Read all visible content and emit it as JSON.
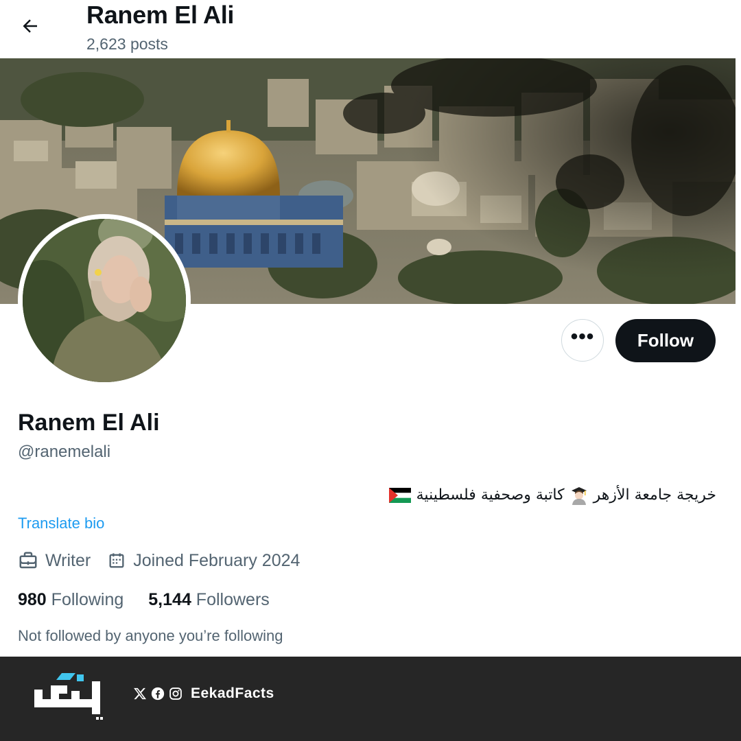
{
  "header": {
    "name": "Ranem El Ali",
    "posts": "2,623 posts"
  },
  "profile": {
    "display_name": "Ranem El Ali",
    "handle": "@ranemelali",
    "bio_text": "خريجة جامعة الأزهر 👩🏻‍🎓 كاتبة وصحفية فلسطينية 🇵🇸",
    "bio_part1": "خريجة جامعة الأزهر",
    "bio_part2": "كاتبة وصحفية فلسطينية",
    "translate_label": "Translate bio",
    "profession": "Writer",
    "joined": "Joined February 2024",
    "following_count": "980",
    "following_label": "Following",
    "followers_count": "5,144",
    "followers_label": "Followers",
    "not_followed": "Not followed by anyone you’re following"
  },
  "actions": {
    "more_label": "•••",
    "follow_label": "Follow"
  },
  "footer": {
    "social_handle": "EekadFacts",
    "icons": [
      "x-icon",
      "facebook-icon",
      "instagram-icon"
    ]
  },
  "colors": {
    "text_primary": "#0f1419",
    "text_secondary": "#536471",
    "link": "#1d9bf0",
    "follow_button": "#0f1419",
    "footer_bg": "#262626"
  }
}
